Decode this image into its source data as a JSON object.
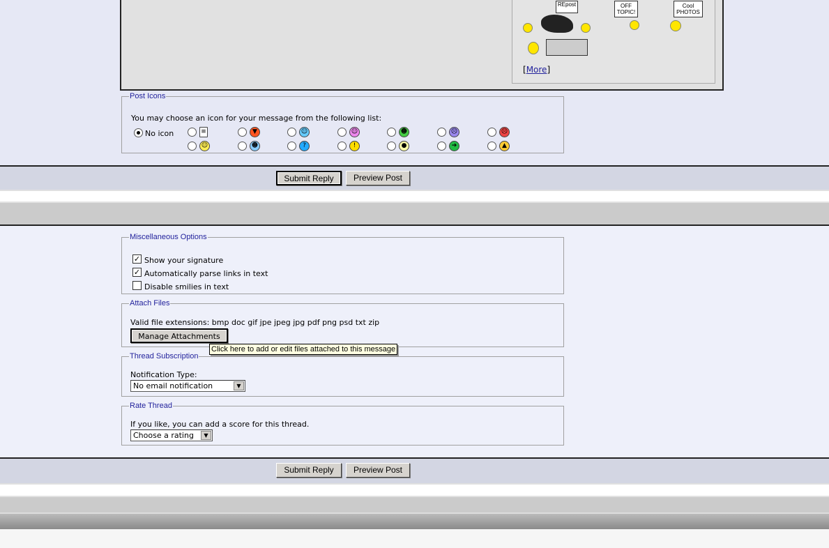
{
  "smilies": {
    "images": [
      {
        "name": "repost-smilie",
        "sign": "REpost"
      },
      {
        "name": "off-topic-smilie",
        "sign": "OFF TOPIC!"
      },
      {
        "name": "cool-photos-smilie",
        "sign": "Cool PHOTOS"
      },
      {
        "name": "clapping-smilie",
        "sign": ""
      }
    ],
    "more_link": "More"
  },
  "post_icons": {
    "legend": "Post Icons",
    "intro": "You may choose an icon for your message from the following list:",
    "no_icon_label": "No icon",
    "selected": "No icon",
    "icons": [
      {
        "name": "post-icon",
        "color": "#ffffff",
        "glyph": "≡"
      },
      {
        "name": "thumbs-down-icon",
        "color": "#ff5522",
        "glyph": "▼"
      },
      {
        "name": "wink-icon",
        "color": "#66ccff",
        "glyph": "☺"
      },
      {
        "name": "smile-pink-icon",
        "color": "#ee88ee",
        "glyph": "☺"
      },
      {
        "name": "grin-icon",
        "color": "#44cc44",
        "glyph": "☻"
      },
      {
        "name": "frown-icon",
        "color": "#9988ee",
        "glyph": "☹"
      },
      {
        "name": "angry-icon",
        "color": "#ee4444",
        "glyph": "☹"
      },
      {
        "name": "smile-icon",
        "color": "#ffee55",
        "glyph": "☺"
      },
      {
        "name": "cool-icon",
        "color": "#88ccff",
        "glyph": "☻"
      },
      {
        "name": "question-icon",
        "color": "#22aaff",
        "glyph": "?"
      },
      {
        "name": "exclamation-icon",
        "color": "#ffdd00",
        "glyph": "!"
      },
      {
        "name": "lightbulb-icon",
        "color": "#ffffaa",
        "glyph": "●"
      },
      {
        "name": "arrow-icon",
        "color": "#22bb44",
        "glyph": "➔"
      },
      {
        "name": "thumbs-up-icon",
        "color": "#ffcc33",
        "glyph": "▲"
      }
    ]
  },
  "buttons": {
    "submit": "Submit Reply",
    "preview": "Preview Post"
  },
  "misc": {
    "legend": "Miscellaneous Options",
    "options": [
      {
        "label": "Show your signature",
        "checked": true
      },
      {
        "label": "Automatically parse links in text",
        "checked": true
      },
      {
        "label": "Disable smilies in text",
        "checked": false
      }
    ]
  },
  "attach": {
    "legend": "Attach Files",
    "extensions": "Valid file extensions: bmp doc gif jpe jpeg jpg pdf png psd txt zip",
    "button": "Manage Attachments",
    "tooltip": "Click here to add or edit files attached to this message"
  },
  "subscription": {
    "legend": "Thread Subscription",
    "label": "Notification Type:",
    "value": "No email notification"
  },
  "rate": {
    "legend": "Rate Thread",
    "label": "If you like, you can add a score for this thread.",
    "value": "Choose a rating"
  }
}
